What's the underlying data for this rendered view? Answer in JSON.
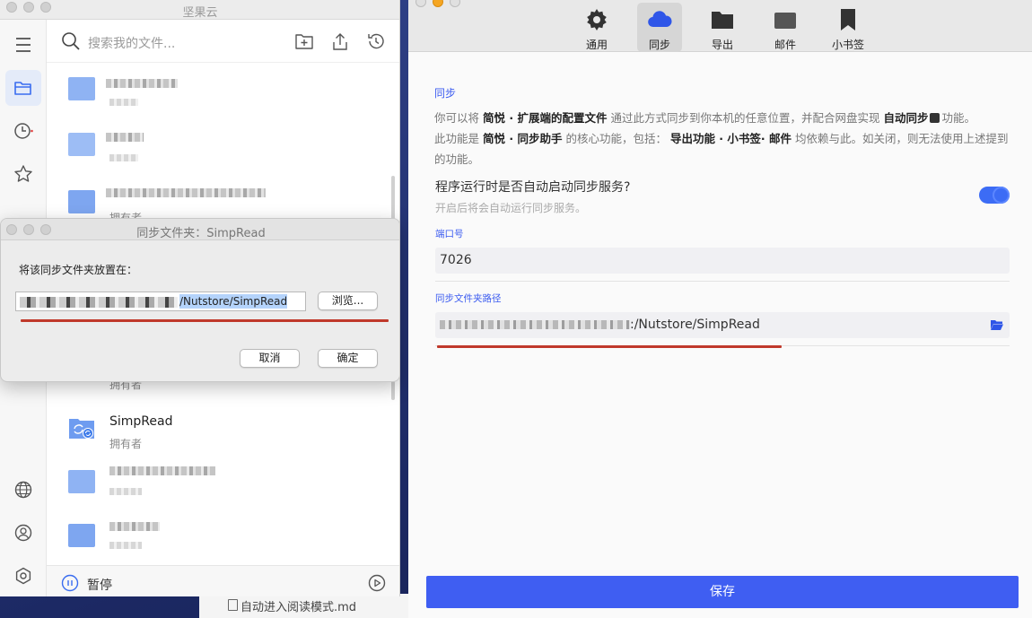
{
  "nutstore": {
    "title": "坚果云",
    "search_placeholder": "搜索我的文件...",
    "files": [
      {
        "name": "",
        "sub": ""
      },
      {
        "name": "",
        "sub": ""
      },
      {
        "name": "",
        "sub": "拥有者"
      },
      {
        "name": "",
        "sub": "拥有者"
      },
      {
        "name": "SimpRead",
        "sub": "拥有者"
      },
      {
        "name": "",
        "sub": ""
      },
      {
        "name": "",
        "sub": ""
      }
    ],
    "pause_label": "暂停"
  },
  "dialog": {
    "title": "同步文件夹：SimpRead",
    "label": "将该同步文件夹放置在：",
    "path_suffix": "/Nutstore/SimpRead",
    "browse_label": "浏览...",
    "cancel_label": "取消",
    "ok_label": "确定"
  },
  "simpread": {
    "tabs": [
      {
        "label": "通用",
        "icon": "gear-icon"
      },
      {
        "label": "同步",
        "icon": "cloud-icon"
      },
      {
        "label": "导出",
        "icon": "folder-icon"
      },
      {
        "label": "邮件",
        "icon": "mail-icon"
      },
      {
        "label": "小书签",
        "icon": "bookmark-icon"
      }
    ],
    "active_tab": "同步",
    "section_title": "同步",
    "desc": {
      "p1": "你可以将",
      "b1": "简悦 · 扩展端的配置文件",
      "p2": "通过此方式同步到你本机的任意位置，并配合网盘实现",
      "b2": "自动同步",
      "p3": "功能。",
      "p4": "此功能是",
      "b3": "简悦 · 同步助手",
      "p5": "的核心功能，包括：",
      "b4": "导出功能 · 小书签· 邮件",
      "p6": "均依赖与此。如关闭，则无法使用上述提到的功能。"
    },
    "autostart_question": "程序运行时是否自动启动同步服务?",
    "autostart_hint": "开启后将会自动运行同步服务。",
    "autostart_on": true,
    "port_label": "端口号",
    "port_value": "7026",
    "path_label": "同步文件夹路径",
    "path_suffix": ":/Nutstore/SimpRead",
    "save_label": "保存"
  },
  "desktop": {
    "behind_file": "自动进入阅读模式.md"
  },
  "colors": {
    "accent": "#3f5ef2",
    "annotation_red": "#c0392b",
    "folder_blue": "#5b8def"
  }
}
